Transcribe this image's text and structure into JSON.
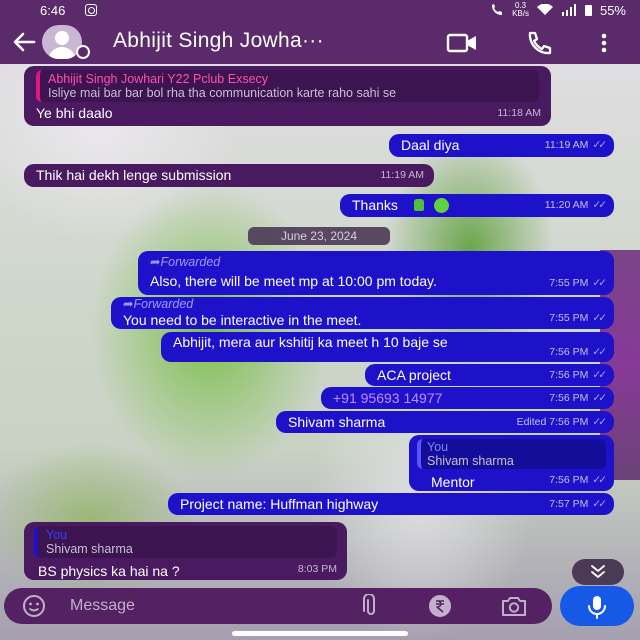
{
  "status_bar": {
    "time": "6:46",
    "kbs_value": "0.3",
    "kbs_unit": "KB/s",
    "battery": "55%"
  },
  "header": {
    "contact_name": "Abhijit Singh Jowha···"
  },
  "messages": [
    {
      "side": "in",
      "quote_name": "Abhijit Singh Jowhari Y22 Pclub Exsecy",
      "quote_text": "Isliye mai bar bar bol rha tha communication karte raho sahi se",
      "text": "Ye bhi daalo",
      "time": "11:18 AM"
    },
    {
      "side": "out",
      "text": "Daal diya",
      "time": "11:19 AM"
    },
    {
      "side": "in",
      "text": "Thik hai dekh lenge submission",
      "time": "11:19 AM"
    },
    {
      "side": "out",
      "text": "Thanks",
      "time": "11:20 AM"
    },
    {
      "side": "out",
      "forwarded_label": "Forwarded",
      "text": "Also, there will be meet mp at 10:00 pm today.",
      "time": "7:55 PM"
    },
    {
      "side": "out",
      "forwarded_label": "Forwarded",
      "text": "You need to be interactive in the meet.",
      "time": "7:55 PM"
    },
    {
      "side": "out",
      "text": "Abhijit, mera aur kshitij ka meet h 10 baje se",
      "time": "7:56 PM"
    },
    {
      "side": "out",
      "text": "ACA project",
      "time": "7:56 PM"
    },
    {
      "side": "out",
      "text": "+91 95693 14977",
      "time": "7:56 PM"
    },
    {
      "side": "out",
      "text": "Shivam sharma",
      "edited_label": "Edited",
      "time": "7:56 PM"
    },
    {
      "side": "out",
      "quote_name": "You",
      "quote_text": "Shivam sharma",
      "text": "Mentor",
      "time": "7:56 PM"
    },
    {
      "side": "out",
      "text": "Project name:  Huffman highway",
      "time": "7:57 PM"
    },
    {
      "side": "in",
      "quote_name": "You",
      "quote_text": "Shivam sharma",
      "text": "BS physics ka hai na ?",
      "time": "8:03 PM"
    }
  ],
  "date_separator": "June 23, 2024",
  "composer": {
    "placeholder": "Message"
  },
  "colors": {
    "app_bar": "#5a2a6b",
    "incoming_bubble": "#4a1a60",
    "outgoing_bubble": "#1d12c9",
    "mic_button": "#1659e6",
    "read_ticks": "#a5a4ff"
  },
  "icons": [
    "back-arrow-icon",
    "avatar-icon",
    "video-call-icon",
    "phone-call-icon",
    "more-vertical-icon",
    "emoji-icon",
    "paperclip-icon",
    "rupee-icon",
    "camera-icon",
    "microphone-icon",
    "scroll-down-icon"
  ]
}
